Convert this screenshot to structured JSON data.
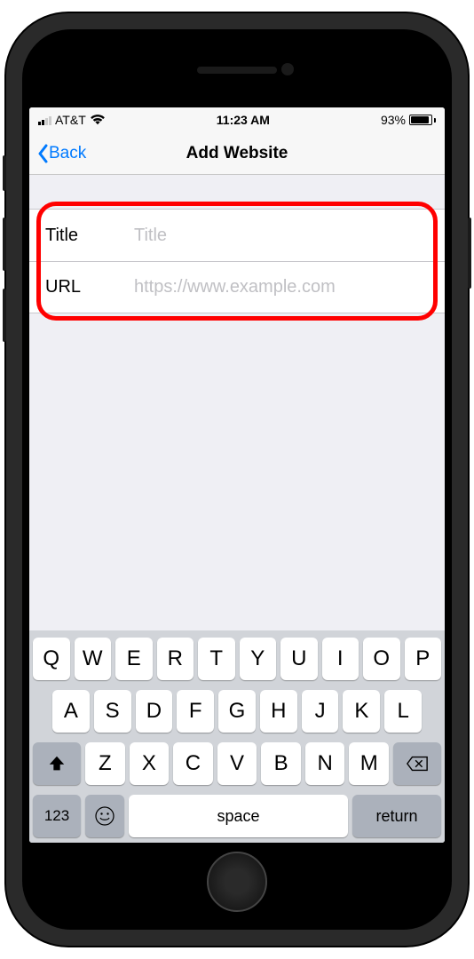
{
  "status": {
    "carrier": "AT&T",
    "time": "11:23 AM",
    "battery_pct": "93%"
  },
  "nav": {
    "back_label": "Back",
    "title": "Add Website"
  },
  "form": {
    "title_label": "Title",
    "title_placeholder": "Title",
    "title_value": "",
    "url_label": "URL",
    "url_placeholder": "https://www.example.com",
    "url_value": ""
  },
  "keyboard": {
    "row1": [
      "Q",
      "W",
      "E",
      "R",
      "T",
      "Y",
      "U",
      "I",
      "O",
      "P"
    ],
    "row2": [
      "A",
      "S",
      "D",
      "F",
      "G",
      "H",
      "J",
      "K",
      "L"
    ],
    "row3": [
      "Z",
      "X",
      "C",
      "V",
      "B",
      "N",
      "M"
    ],
    "numbers_key": "123",
    "space_key": "space",
    "return_key": "return"
  }
}
